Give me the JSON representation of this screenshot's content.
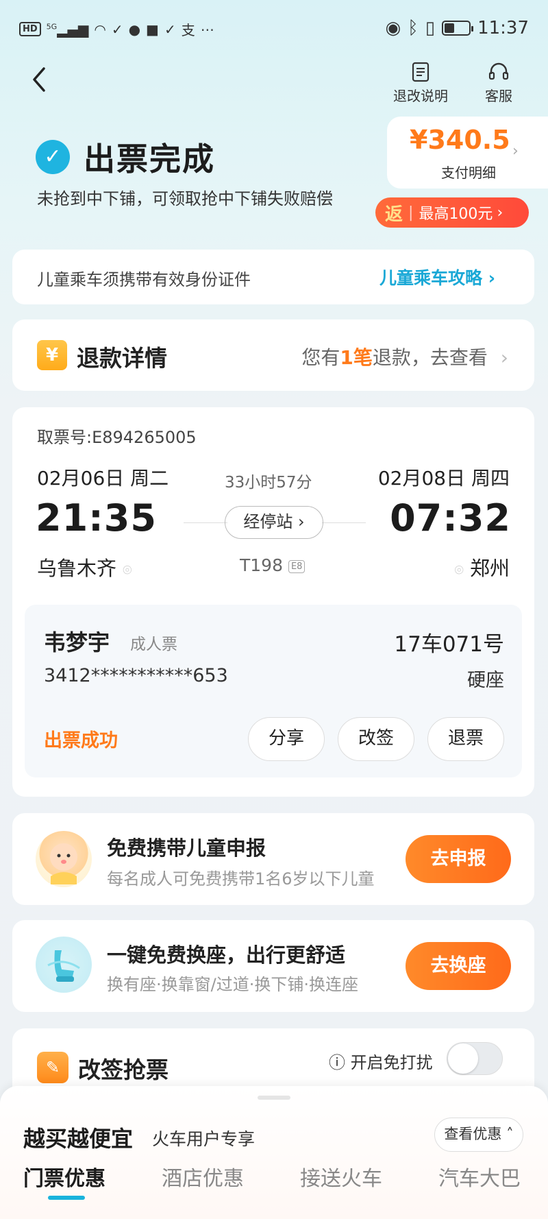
{
  "status_bar": {
    "hd": "HD",
    "signal": "5G",
    "time": "11:37"
  },
  "header": {
    "back_icon": "chevron-left-icon",
    "refund_policy_label": "退改说明",
    "customer_service_label": "客服"
  },
  "order": {
    "title": "出票完成",
    "subtitle": "未抢到中下铺，可领取抢中下铺失败赔偿",
    "price": "¥340.5",
    "price_detail_label": "支付明细",
    "rebate_tag": "返",
    "rebate_text": "最高100元",
    "brand_color": "#1aa8d6",
    "accent_color": "#ff7a1a"
  },
  "notice": {
    "text": "儿童乘车须携带有效身份证件",
    "link": "儿童乘车攻略 ›"
  },
  "refund": {
    "icon": "¥",
    "title": "退款详情",
    "prefix": "您有",
    "count": "1笔",
    "suffix": "退款，去查看"
  },
  "ticket": {
    "pickup_no": "取票号:E894265005",
    "departure_date": "02月06日 周二",
    "arrival_date": "02月08日 周四",
    "duration": "33小时57分",
    "departure_time": "21:35",
    "arrival_time": "07:32",
    "stops_label": "经停站 ›",
    "departure_station": "乌鲁木齐",
    "arrival_station": "郑州",
    "train_no": "T198",
    "train_badge": "E8",
    "passenger": {
      "name": "韦梦宇",
      "ticket_type": "成人票",
      "seat": "17车071号",
      "id_number": "3412***********653",
      "seat_class": "硬座",
      "status": "出票成功",
      "actions": [
        "分享",
        "改签",
        "退票"
      ]
    }
  },
  "promos": [
    {
      "title": "免费携带儿童申报",
      "subtitle": "每名成人可免费携带1名6岁以下儿童",
      "button": "去申报",
      "icon": "baby-icon"
    },
    {
      "title": "一键免费换座，出行更舒适",
      "subtitle": "换有座·换靠窗/过道·换下铺·换连座",
      "button": "去换座",
      "icon": "seat-icon"
    }
  ],
  "reschedule": {
    "title": "改签抢票",
    "dnd_label": "ⓘ 开启免打扰"
  },
  "bottom_sheet": {
    "title": "越买越便宜",
    "subtitle": "火车用户专享",
    "button": "查看优惠 ˄",
    "tabs": [
      "门票优惠",
      "酒店优惠",
      "接送火车",
      "汽车大巴"
    ]
  }
}
